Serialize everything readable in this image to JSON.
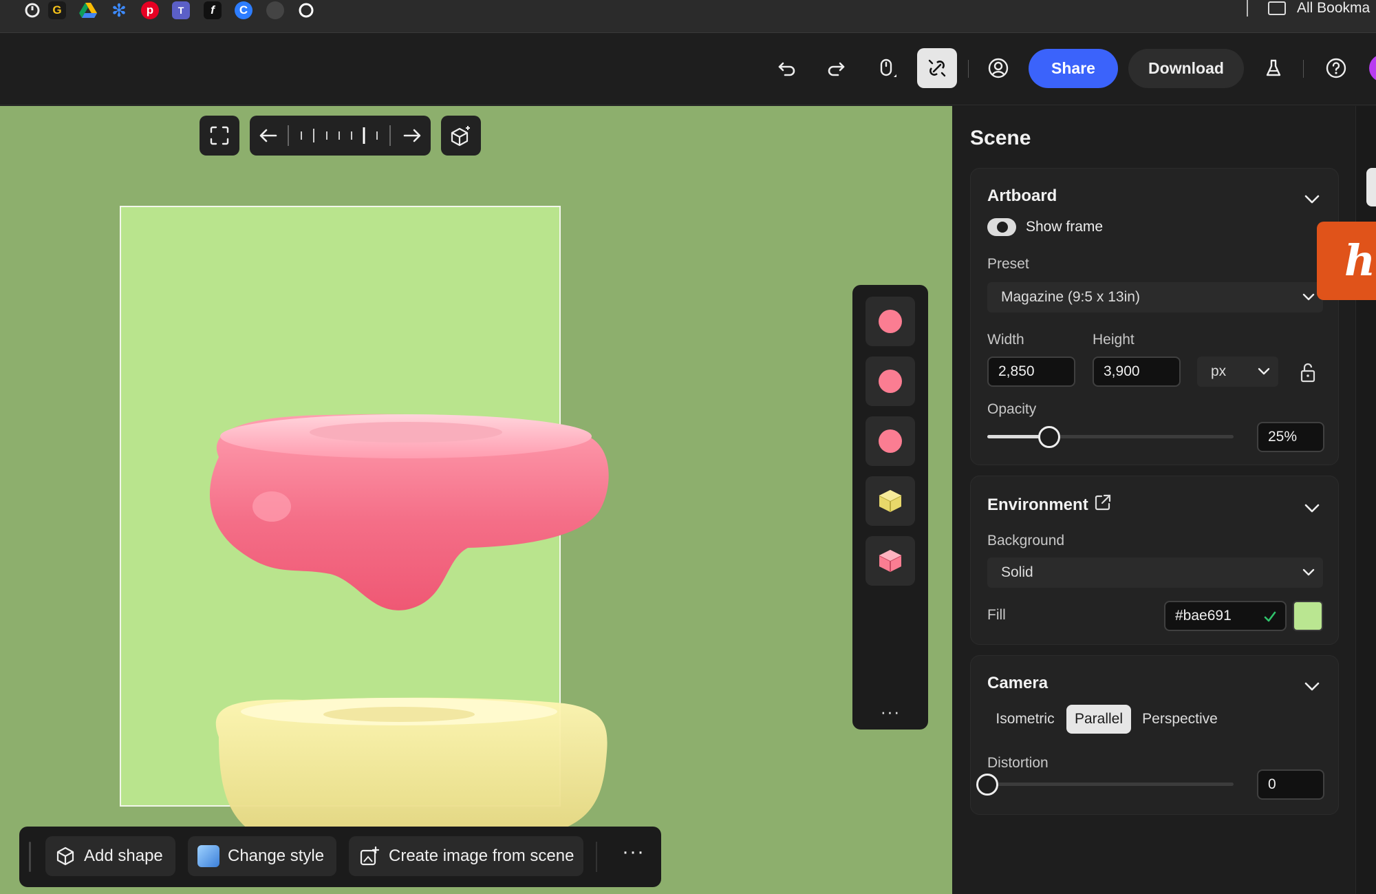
{
  "bookmarks": {
    "icons": [
      "timer-icon",
      "g-icon",
      "google-drive-icon",
      "asterisk-icon",
      "pinterest-icon",
      "teams-icon",
      "function-icon",
      "c-icon",
      "sphere-icon",
      "circle-icon"
    ],
    "all_label": "All Bookma"
  },
  "header": {
    "share_label": "Share",
    "download_label": "Download"
  },
  "canvas": {
    "background_color": "#8daf6d",
    "artboard_color": "#bae691",
    "layers": [
      {
        "type": "sphere",
        "color": "#fb7d92"
      },
      {
        "type": "sphere",
        "color": "#fb7d92"
      },
      {
        "type": "sphere",
        "color": "#fb7d92"
      },
      {
        "type": "cube",
        "color": "#e8d86a"
      },
      {
        "type": "cube",
        "color": "#fb7d92"
      }
    ],
    "more_label": "···"
  },
  "bottom_bar": {
    "add_shape_label": "Add shape",
    "change_style_label": "Change style",
    "create_image_label": "Create image from scene",
    "more_label": "···"
  },
  "panel": {
    "title": "Scene",
    "artboard": {
      "title": "Artboard",
      "show_frame_label": "Show frame",
      "preset_label": "Preset",
      "preset_value": "Magazine (9:5 x 13in)",
      "width_label": "Width",
      "width_value": "2,850",
      "height_label": "Height",
      "height_value": "3,900",
      "unit_value": "px",
      "opacity_label": "Opacity",
      "opacity_value": "25%",
      "opacity_fraction": 0.25
    },
    "environment": {
      "title": "Environment",
      "background_label": "Background",
      "background_value": "Solid",
      "fill_label": "Fill",
      "fill_value": "#bae691",
      "fill_color": "#bae691"
    },
    "camera": {
      "title": "Camera",
      "modes": [
        "Isometric",
        "Parallel",
        "Perspective"
      ],
      "active_mode": "Parallel",
      "distortion_label": "Distortion",
      "distortion_value": "0",
      "distortion_fraction": 0
    }
  },
  "colors": {
    "accent": "#3b63fb",
    "orange_tab": "#e0531a"
  }
}
